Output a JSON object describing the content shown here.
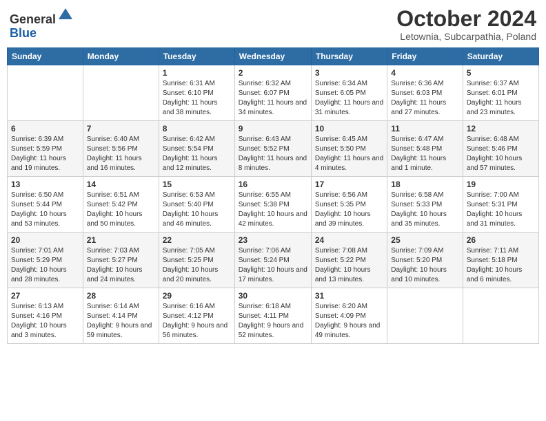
{
  "header": {
    "logo_general": "General",
    "logo_blue": "Blue",
    "month_title": "October 2024",
    "subtitle": "Letownia, Subcarpathia, Poland"
  },
  "weekdays": [
    "Sunday",
    "Monday",
    "Tuesday",
    "Wednesday",
    "Thursday",
    "Friday",
    "Saturday"
  ],
  "weeks": [
    [
      {
        "day": "",
        "info": ""
      },
      {
        "day": "",
        "info": ""
      },
      {
        "day": "1",
        "info": "Sunrise: 6:31 AM\nSunset: 6:10 PM\nDaylight: 11 hours and 38 minutes."
      },
      {
        "day": "2",
        "info": "Sunrise: 6:32 AM\nSunset: 6:07 PM\nDaylight: 11 hours and 34 minutes."
      },
      {
        "day": "3",
        "info": "Sunrise: 6:34 AM\nSunset: 6:05 PM\nDaylight: 11 hours and 31 minutes."
      },
      {
        "day": "4",
        "info": "Sunrise: 6:36 AM\nSunset: 6:03 PM\nDaylight: 11 hours and 27 minutes."
      },
      {
        "day": "5",
        "info": "Sunrise: 6:37 AM\nSunset: 6:01 PM\nDaylight: 11 hours and 23 minutes."
      }
    ],
    [
      {
        "day": "6",
        "info": "Sunrise: 6:39 AM\nSunset: 5:59 PM\nDaylight: 11 hours and 19 minutes."
      },
      {
        "day": "7",
        "info": "Sunrise: 6:40 AM\nSunset: 5:56 PM\nDaylight: 11 hours and 16 minutes."
      },
      {
        "day": "8",
        "info": "Sunrise: 6:42 AM\nSunset: 5:54 PM\nDaylight: 11 hours and 12 minutes."
      },
      {
        "day": "9",
        "info": "Sunrise: 6:43 AM\nSunset: 5:52 PM\nDaylight: 11 hours and 8 minutes."
      },
      {
        "day": "10",
        "info": "Sunrise: 6:45 AM\nSunset: 5:50 PM\nDaylight: 11 hours and 4 minutes."
      },
      {
        "day": "11",
        "info": "Sunrise: 6:47 AM\nSunset: 5:48 PM\nDaylight: 11 hours and 1 minute."
      },
      {
        "day": "12",
        "info": "Sunrise: 6:48 AM\nSunset: 5:46 PM\nDaylight: 10 hours and 57 minutes."
      }
    ],
    [
      {
        "day": "13",
        "info": "Sunrise: 6:50 AM\nSunset: 5:44 PM\nDaylight: 10 hours and 53 minutes."
      },
      {
        "day": "14",
        "info": "Sunrise: 6:51 AM\nSunset: 5:42 PM\nDaylight: 10 hours and 50 minutes."
      },
      {
        "day": "15",
        "info": "Sunrise: 6:53 AM\nSunset: 5:40 PM\nDaylight: 10 hours and 46 minutes."
      },
      {
        "day": "16",
        "info": "Sunrise: 6:55 AM\nSunset: 5:38 PM\nDaylight: 10 hours and 42 minutes."
      },
      {
        "day": "17",
        "info": "Sunrise: 6:56 AM\nSunset: 5:35 PM\nDaylight: 10 hours and 39 minutes."
      },
      {
        "day": "18",
        "info": "Sunrise: 6:58 AM\nSunset: 5:33 PM\nDaylight: 10 hours and 35 minutes."
      },
      {
        "day": "19",
        "info": "Sunrise: 7:00 AM\nSunset: 5:31 PM\nDaylight: 10 hours and 31 minutes."
      }
    ],
    [
      {
        "day": "20",
        "info": "Sunrise: 7:01 AM\nSunset: 5:29 PM\nDaylight: 10 hours and 28 minutes."
      },
      {
        "day": "21",
        "info": "Sunrise: 7:03 AM\nSunset: 5:27 PM\nDaylight: 10 hours and 24 minutes."
      },
      {
        "day": "22",
        "info": "Sunrise: 7:05 AM\nSunset: 5:25 PM\nDaylight: 10 hours and 20 minutes."
      },
      {
        "day": "23",
        "info": "Sunrise: 7:06 AM\nSunset: 5:24 PM\nDaylight: 10 hours and 17 minutes."
      },
      {
        "day": "24",
        "info": "Sunrise: 7:08 AM\nSunset: 5:22 PM\nDaylight: 10 hours and 13 minutes."
      },
      {
        "day": "25",
        "info": "Sunrise: 7:09 AM\nSunset: 5:20 PM\nDaylight: 10 hours and 10 minutes."
      },
      {
        "day": "26",
        "info": "Sunrise: 7:11 AM\nSunset: 5:18 PM\nDaylight: 10 hours and 6 minutes."
      }
    ],
    [
      {
        "day": "27",
        "info": "Sunrise: 6:13 AM\nSunset: 4:16 PM\nDaylight: 10 hours and 3 minutes."
      },
      {
        "day": "28",
        "info": "Sunrise: 6:14 AM\nSunset: 4:14 PM\nDaylight: 9 hours and 59 minutes."
      },
      {
        "day": "29",
        "info": "Sunrise: 6:16 AM\nSunset: 4:12 PM\nDaylight: 9 hours and 56 minutes."
      },
      {
        "day": "30",
        "info": "Sunrise: 6:18 AM\nSunset: 4:11 PM\nDaylight: 9 hours and 52 minutes."
      },
      {
        "day": "31",
        "info": "Sunrise: 6:20 AM\nSunset: 4:09 PM\nDaylight: 9 hours and 49 minutes."
      },
      {
        "day": "",
        "info": ""
      },
      {
        "day": "",
        "info": ""
      }
    ]
  ]
}
